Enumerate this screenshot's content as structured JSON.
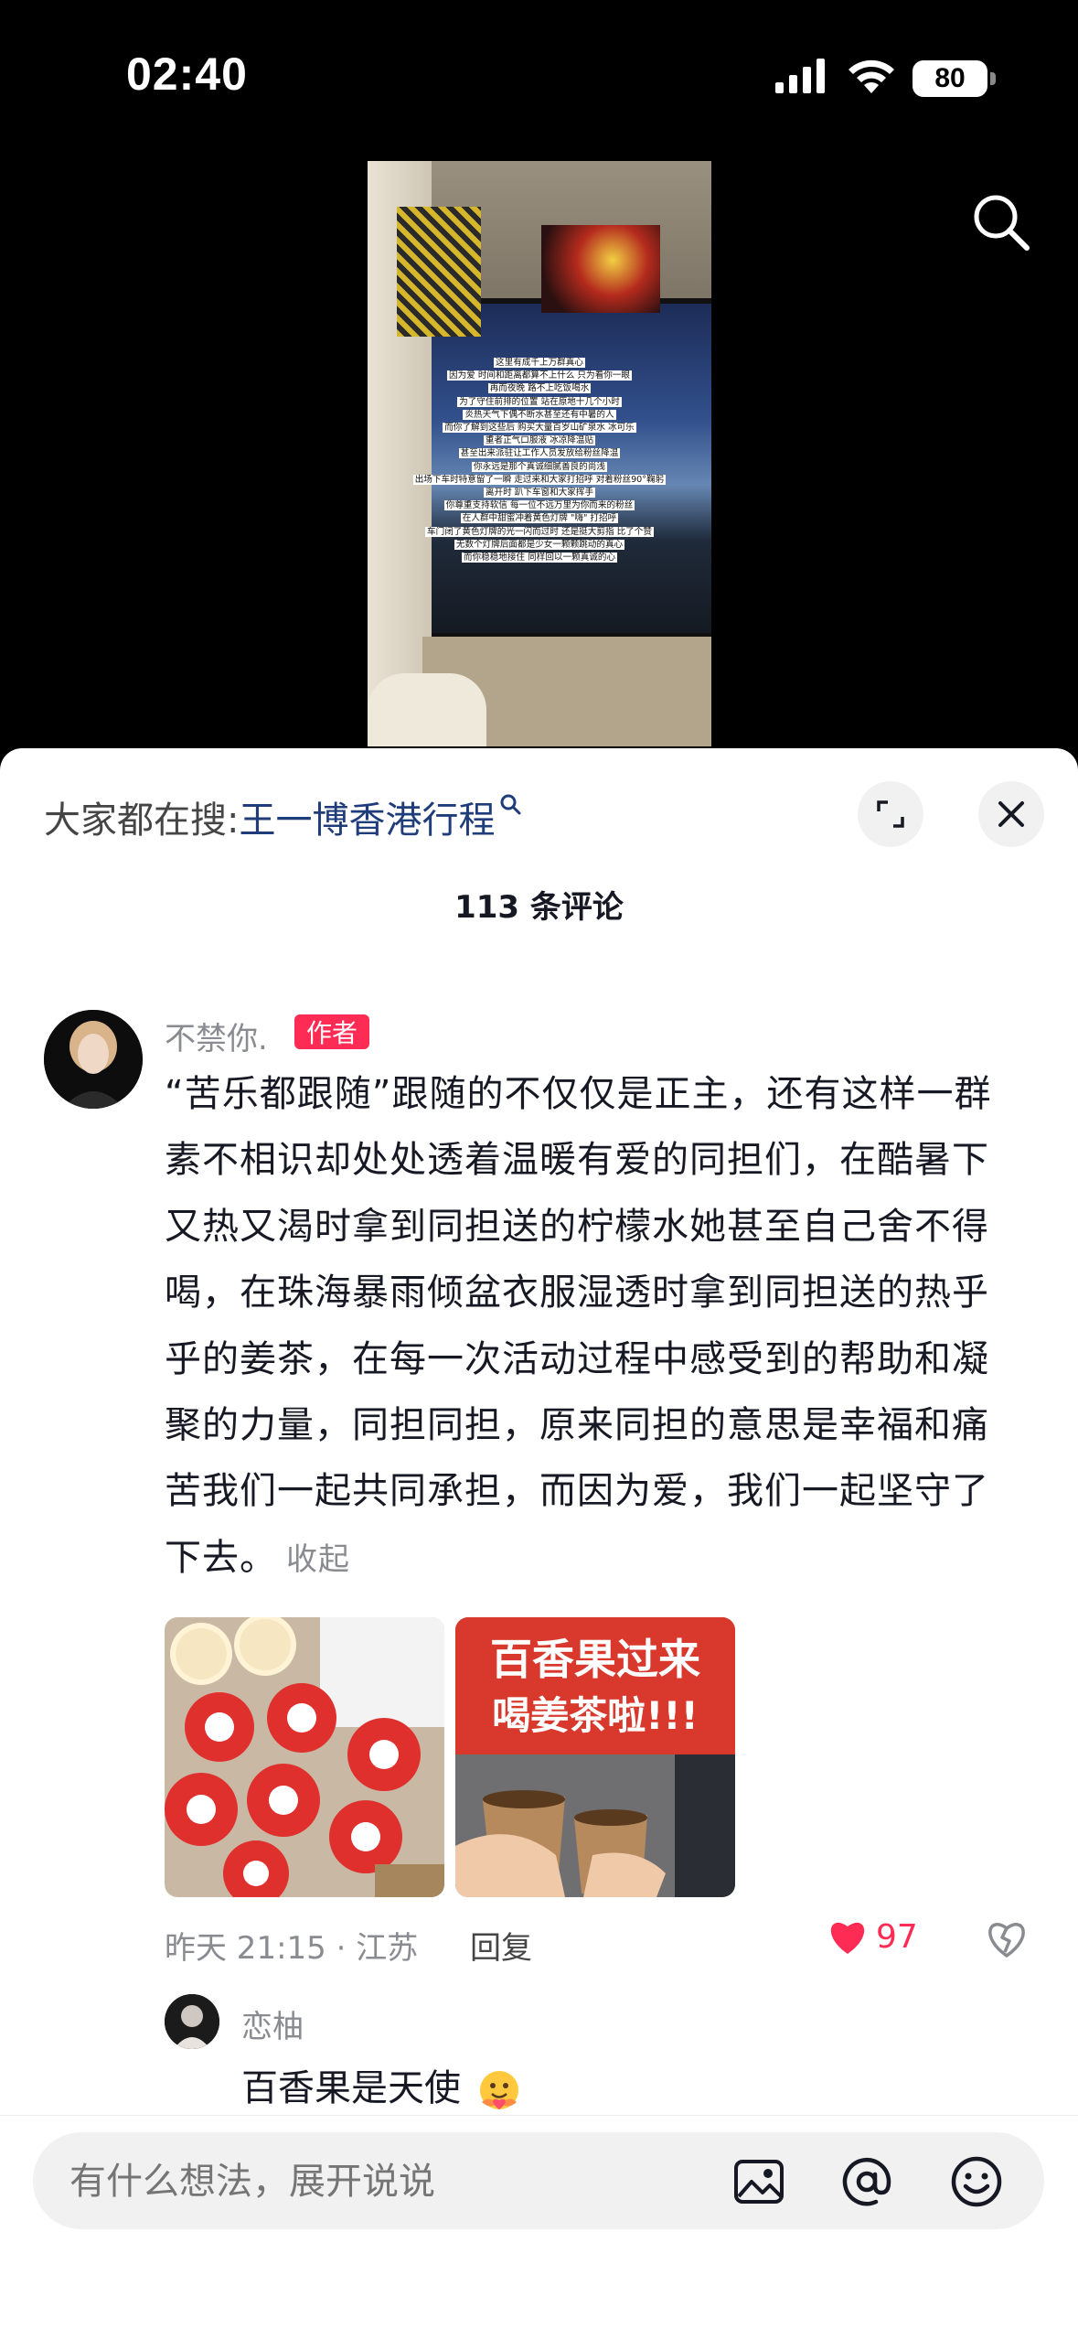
{
  "status_bar": {
    "time": "02:40",
    "battery": "80"
  },
  "video": {
    "overlay_lines": [
      "这里有成千上万群真心",
      "因为爱 时间和距离都算不上什么 只为看你一眼",
      "再而夜晚 路不上吃饭喝水",
      "为了守住前排的位置 站在原地十几个小时",
      "炎热天气下偶不断水甚至还有中暑的人",
      "而你了解到这些后 购买大量百岁山矿泉水 冰可乐",
      "重者正气口服液 冰凉降温贴",
      "甚至出来派驻让工作人员发放给粉丝降温",
      "你永远是那个真诚细腻善良的尚浅",
      "出场下车时特意留了一瞬 走过来和大家打招呼 对着粉丝90°鞠躬",
      "离开时 趴下车窗和大家挥手",
      "你尊重支持软信 每一位不远万里为你而来的粉丝",
      "在人群中甜蜜冲着黄色灯牌 \"嗨\" 打招呼",
      "车门闭了黄色灯牌的光一闪而过时 还是挺大剪指 比了个赞",
      "无数个灯牌后面都是少女一颗颗跳动的真心",
      "而你稳稳地接住 同样回以一颗真诚的心"
    ]
  },
  "sheet": {
    "hot_search_prefix": "大家都在搜:",
    "hot_search_keyword": "王一博香港行程",
    "comment_count": "113 条评论"
  },
  "comment": {
    "username": "不禁你.",
    "author_badge": "作者",
    "text": "“苦乐都跟随”跟随的不仅仅是正主，还有这样一群素不相识却处处透着温暖有爱的同担们，在酷暑下又热又渴时拿到同担送的柠檬水她甚至自己舍不得喝，在珠海暴雨倾盆衣服湿透时拿到同担送的热乎乎的姜茶，在每一次活动过程中感受到的帮助和凝聚的力量，同担同担，原来同担的意思是幸福和痛苦我们一起共同承担，而因为爱，我们一起坚守了下去。",
    "collapse_label": "收起",
    "image2_sign_line1": "百香果过来",
    "image2_sign_line2": "喝姜茶啦!!!",
    "time_location": "昨天 21:15 · 江苏",
    "reply_label": "回复",
    "like_count": "97"
  },
  "reply": {
    "username": "恋柚",
    "text": "百香果是天使"
  },
  "input_bar": {
    "placeholder": "有什么想法，展开说说"
  },
  "colors": {
    "accent_red": "#fe2c55",
    "keyword_blue": "#1f3d7a",
    "secondary_text": "#8a8b91"
  }
}
